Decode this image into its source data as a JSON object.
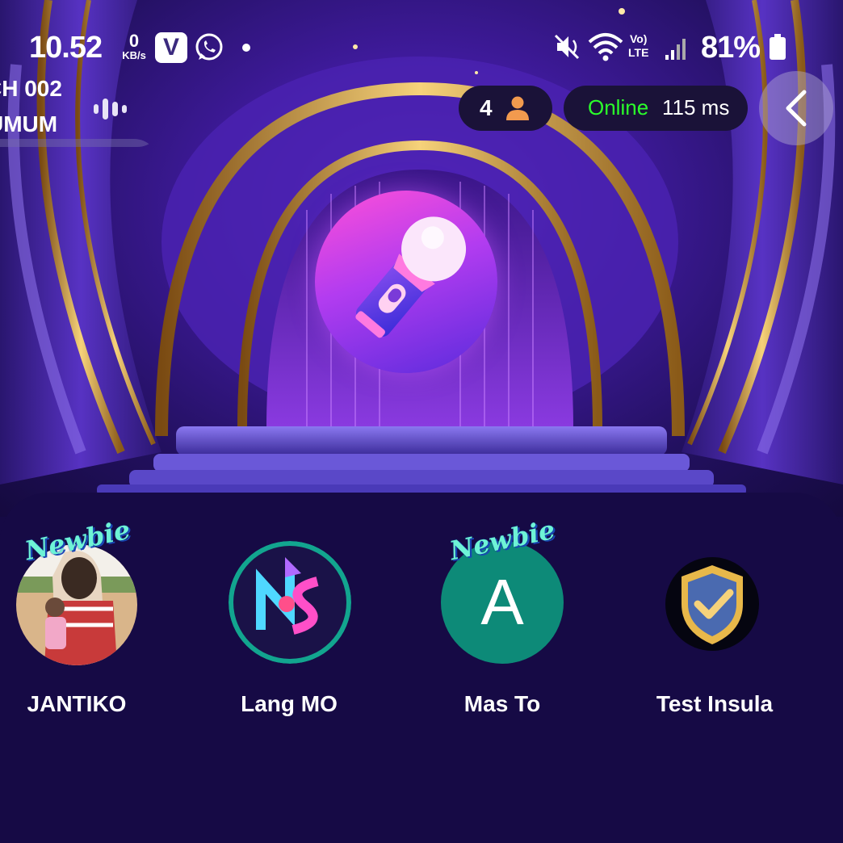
{
  "status_bar": {
    "time": "10.52",
    "net_speed_value": "0",
    "net_speed_unit": "KB/s",
    "app_icon_v": "V",
    "lte_top": "Vo)",
    "lte_bottom": "LTE",
    "battery": "81%"
  },
  "room": {
    "line1": "CH 002",
    "line2": "UMUM"
  },
  "header": {
    "listener_count": "4",
    "online_label": "Online",
    "ping": "115 ms"
  },
  "icons": {
    "back": "chevron-left-icon",
    "user": "user-icon",
    "mic": "microphone-icon"
  },
  "seats": [
    {
      "name": "JANTIKO",
      "badge": "Newbie"
    },
    {
      "name": "Lang MO",
      "badge": ""
    },
    {
      "name": "Mas To",
      "badge": "Newbie",
      "initial": "A"
    },
    {
      "name": "Test Insula",
      "badge": ""
    }
  ],
  "colors": {
    "online": "#2bff2b",
    "panel": "#160a45",
    "mas_to_avatar": "#0d8a78"
  }
}
